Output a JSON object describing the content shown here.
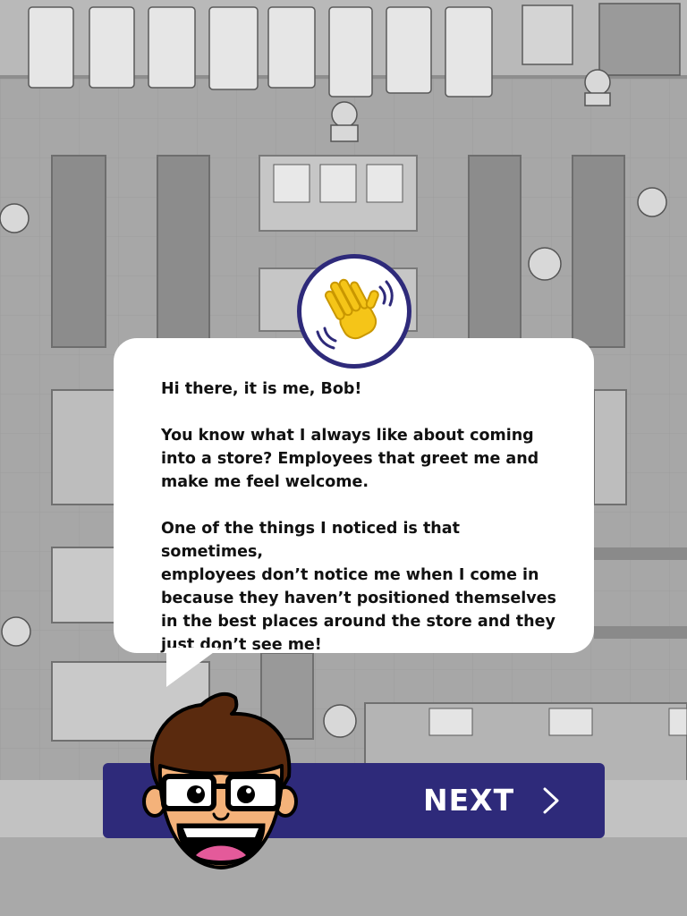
{
  "dialog": {
    "greeting": "Hi there, it is me, Bob!",
    "line1": "You know what I always like about coming",
    "line2": "into a store?  Employees that greet me and",
    "line3": "make me feel welcome.",
    "line4": "One of the things I noticed is that sometimes,",
    "line5": "employees don’t notice me when I come in",
    "line6": "because they haven’t positioned themselves",
    "line7": "in the best places around the store and they",
    "line8": "just don’t see me!"
  },
  "next_button": {
    "label": "NEXT"
  },
  "icons": {
    "wave": "waving-hand-icon",
    "next": "chevron-right-icon",
    "character": "bob-avatar"
  },
  "colors": {
    "button": "#2e2a7a",
    "badge_border": "#2e2a7a",
    "hand": "#f5c518",
    "background": "#a9a9a9"
  }
}
